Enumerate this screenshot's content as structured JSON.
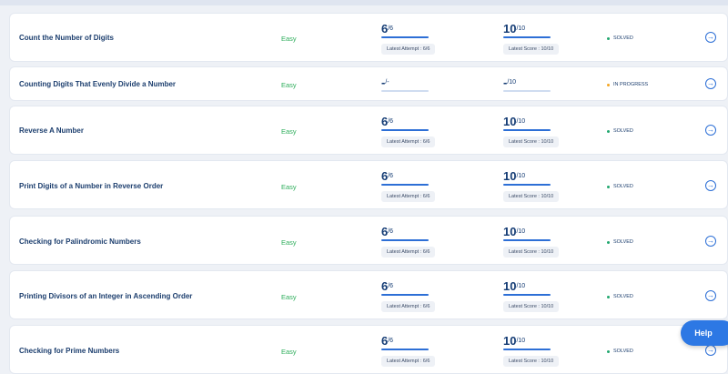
{
  "colors": {
    "accent": "#2d6fd6",
    "easy": "#2fae5c",
    "solved": "#23a870",
    "in_progress": "#f5a623"
  },
  "help_label": "Help",
  "rows": [
    {
      "title": "Count the Number of Digits",
      "difficulty": "Easy",
      "attempt_big": "6",
      "attempt_sup": "/6",
      "attempt_pill": "Latest Attempt : 6/6",
      "score_big": "10",
      "score_sup": "/10",
      "score_pill": "Latest Score : 10/10",
      "status": "SOLVED",
      "status_kind": "solved"
    },
    {
      "title": "Counting Digits That Evenly Divide a Number",
      "difficulty": "Easy",
      "attempt_big": "-",
      "attempt_sup": "/-",
      "attempt_pill": "",
      "score_big": "-",
      "score_sup": "/10",
      "score_pill": "",
      "status": "IN PROGRESS",
      "status_kind": "in_progress"
    },
    {
      "title": "Reverse A Number",
      "difficulty": "Easy",
      "attempt_big": "6",
      "attempt_sup": "/6",
      "attempt_pill": "Latest Attempt : 6/6",
      "score_big": "10",
      "score_sup": "/10",
      "score_pill": "Latest Score : 10/10",
      "status": "SOLVED",
      "status_kind": "solved"
    },
    {
      "title": "Print Digits of a Number in Reverse Order",
      "difficulty": "Easy",
      "attempt_big": "6",
      "attempt_sup": "/6",
      "attempt_pill": "Latest Attempt : 6/6",
      "score_big": "10",
      "score_sup": "/10",
      "score_pill": "Latest Score : 10/10",
      "status": "SOLVED",
      "status_kind": "solved"
    },
    {
      "title": "Checking for Palindromic Numbers",
      "difficulty": "Easy",
      "attempt_big": "6",
      "attempt_sup": "/6",
      "attempt_pill": "Latest Attempt : 6/6",
      "score_big": "10",
      "score_sup": "/10",
      "score_pill": "Latest Score : 10/10",
      "status": "SOLVED",
      "status_kind": "solved"
    },
    {
      "title": "Printing Divisors of an Integer in Ascending Order",
      "difficulty": "Easy",
      "attempt_big": "6",
      "attempt_sup": "/6",
      "attempt_pill": "Latest Attempt : 6/6",
      "score_big": "10",
      "score_sup": "/10",
      "score_pill": "Latest Score : 10/10",
      "status": "SOLVED",
      "status_kind": "solved"
    },
    {
      "title": "Checking for Prime Numbers",
      "difficulty": "Easy",
      "attempt_big": "6",
      "attempt_sup": "/6",
      "attempt_pill": "Latest Attempt : 6/6",
      "score_big": "10",
      "score_sup": "/10",
      "score_pill": "Latest Score : 10/10",
      "status": "SOLVED",
      "status_kind": "solved"
    }
  ]
}
